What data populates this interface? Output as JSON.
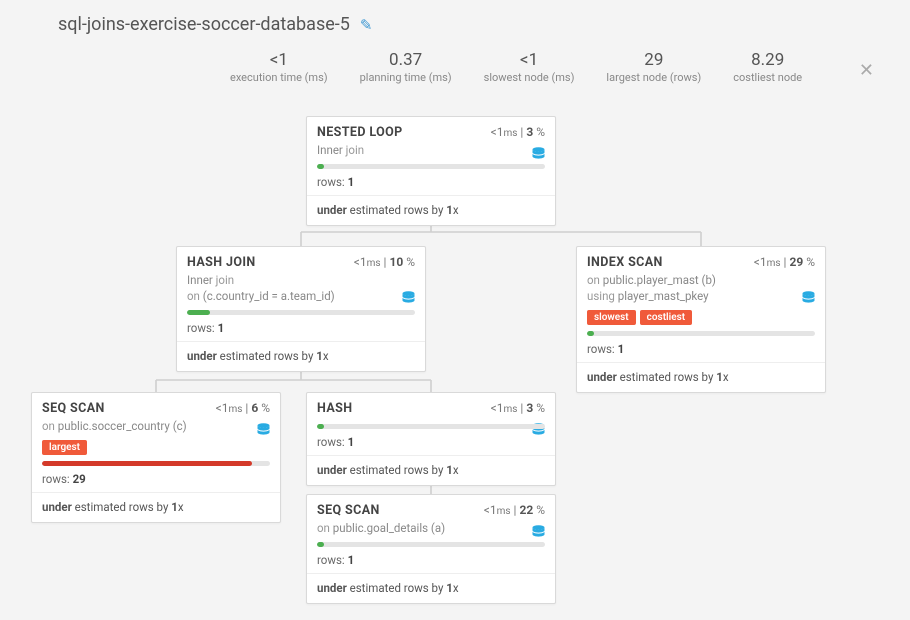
{
  "title": "sql-joins-exercise-soccer-database-5",
  "stats": {
    "exec_time": {
      "value": "<1",
      "label": "execution time (ms)"
    },
    "plan_time": {
      "value": "0.37",
      "label": "planning time (ms)"
    },
    "slowest": {
      "value": "<1",
      "label": "slowest node (ms)"
    },
    "largest": {
      "value": "29",
      "label": "largest node (rows)"
    },
    "costliest": {
      "value": "8.29",
      "label": "costliest node"
    }
  },
  "nodes": {
    "nested_loop": {
      "title": "NESTED LOOP",
      "time": "<1",
      "pct": "3",
      "sub1_a": "Inner",
      "sub1_b": " join",
      "bar_pct": 3,
      "bar_color": "green",
      "rows": "1",
      "est": "1"
    },
    "hash_join": {
      "title": "HASH JOIN",
      "time": "<1",
      "pct": "10",
      "sub1_a": "Inner",
      "sub1_b": " join",
      "sub2_a": "on",
      "sub2_b": " (c.country_id = a.team_id)",
      "bar_pct": 10,
      "bar_color": "green",
      "rows": "1",
      "est": "1"
    },
    "index_scan": {
      "title": "INDEX SCAN",
      "time": "<1",
      "pct": "29",
      "sub1_a": "on",
      "sub1_b": " public.player_mast (b)",
      "sub2_a": "using",
      "sub2_b": " player_mast_pkey",
      "badges": [
        "slowest",
        "costliest"
      ],
      "bar_pct": 3,
      "bar_color": "green",
      "rows": "1",
      "est": "1"
    },
    "seq_scan_c": {
      "title": "SEQ SCAN",
      "time": "<1",
      "pct": "6",
      "sub1_a": "on",
      "sub1_b": " public.soccer_country (c)",
      "badges": [
        "largest"
      ],
      "bar_pct": 92,
      "bar_color": "red",
      "rows": "29",
      "est": "1"
    },
    "hash": {
      "title": "HASH",
      "time": "<1",
      "pct": "3",
      "bar_pct": 3,
      "bar_color": "green",
      "rows": "1",
      "est": "1"
    },
    "seq_scan_a": {
      "title": "SEQ SCAN",
      "time": "<1",
      "pct": "22",
      "sub1_a": "on",
      "sub1_b": " public.goal_details (a)",
      "bar_pct": 3,
      "bar_color": "green",
      "rows": "1",
      "est": "1"
    }
  },
  "labels": {
    "rows": "rows:",
    "under": "under",
    "estimated": " estimated rows by ",
    "x": "x",
    "ms": "ms",
    "pct_sign": " %",
    "pipe": " | "
  }
}
